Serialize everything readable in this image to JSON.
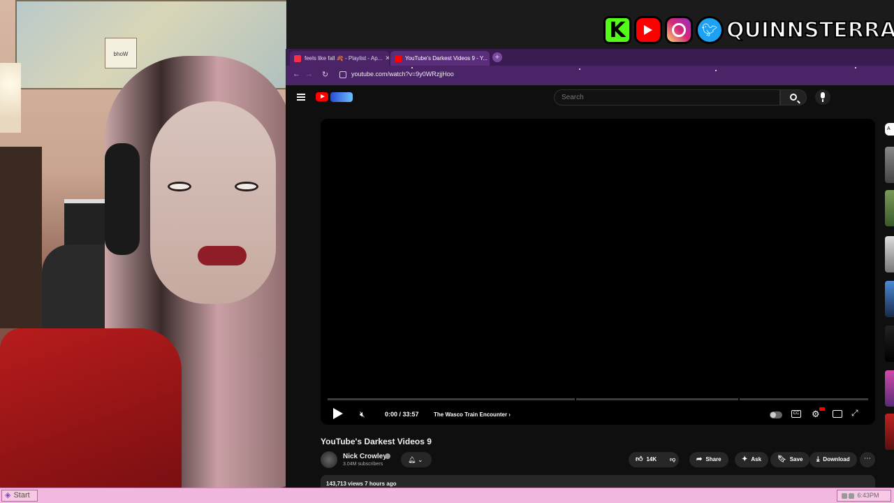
{
  "overlay": {
    "kick_letter": "K",
    "handle": "QUINNSTERRAT",
    "icons": [
      "kick-icon",
      "youtube-icon",
      "instagram-icon",
      "twitter-icon"
    ]
  },
  "webcam": {
    "map_card_text": "bhoW"
  },
  "browser": {
    "tabs": [
      {
        "label": "feels like fall 🍂 - Playlist - Ap...",
        "icon": "music-icon",
        "color": "#fa2d48"
      },
      {
        "label": "YouTube's Darkest Videos 9 - Y...",
        "icon": "youtube-icon",
        "color": "#ff0000"
      }
    ],
    "new_tab": "+",
    "url": "youtube.com/watch?v=9y0WRzjjHoo"
  },
  "youtube": {
    "search_placeholder": "Search",
    "player": {
      "time": "0:00 / 33:57",
      "chapter": "The Wasco Train Encounter",
      "cc_label": "CC"
    },
    "video_title": "YouTube's Darkest Videos 9",
    "channel_name": "Nick Crowley",
    "subscribers": "3.04M subscribers",
    "likes": "14K",
    "share": "Share",
    "ask": "Ask",
    "save": "Save",
    "download": "Download",
    "views_line": "143,713 views  7 hours ago",
    "sidebar_chip": "A"
  },
  "taskbar": {
    "start": "Start",
    "clock": "6:43PM"
  },
  "colors": {
    "browser_frame": "#4a2466",
    "taskbar": "#f3b8e0",
    "youtube_red": "#ff0000"
  }
}
